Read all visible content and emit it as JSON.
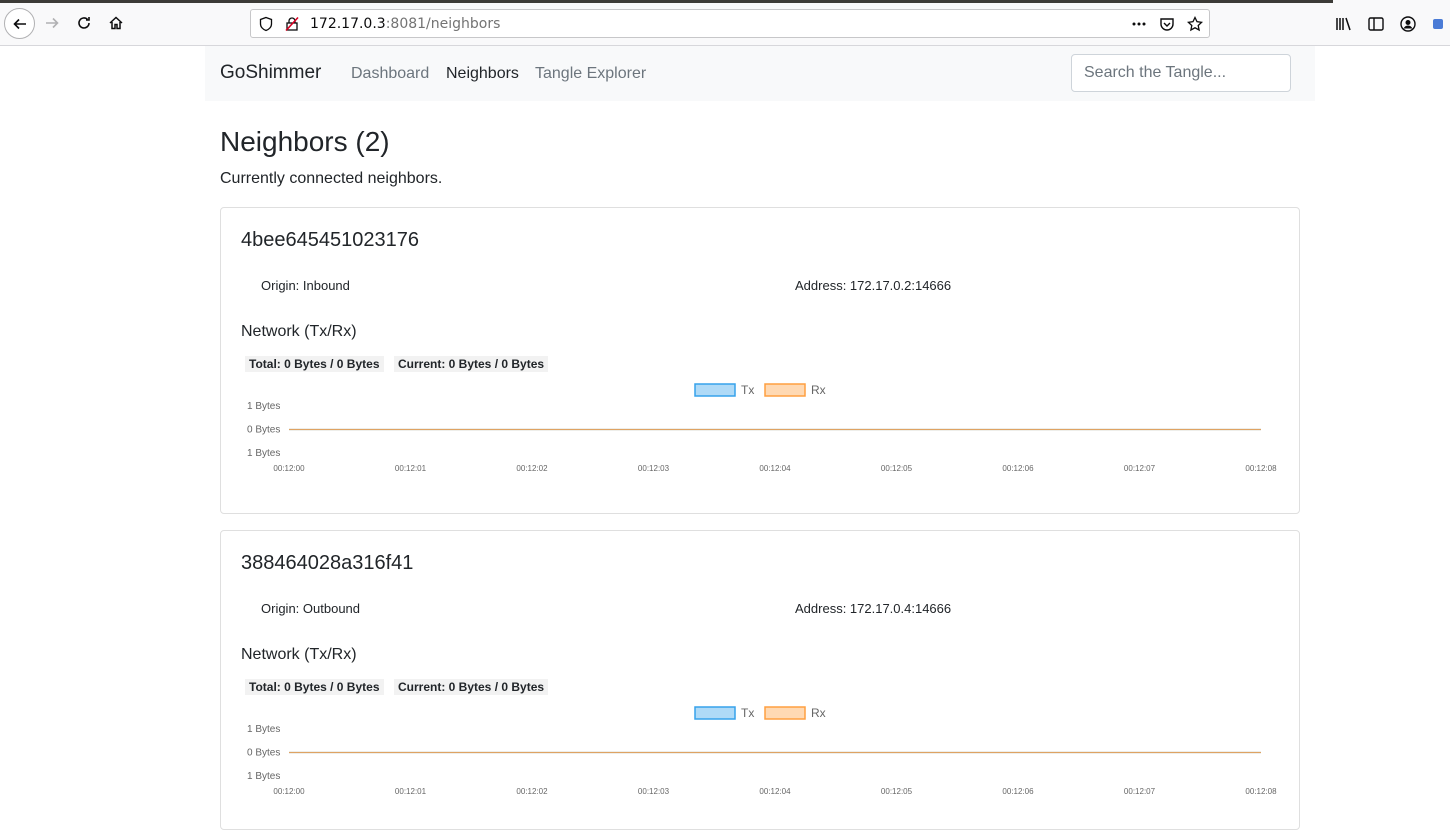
{
  "browser": {
    "url_host": "172.17.0.3",
    "url_rest": ":8081/neighbors"
  },
  "navbar": {
    "brand": "GoShimmer",
    "links": [
      "Dashboard",
      "Neighbors",
      "Tangle Explorer"
    ],
    "active_link": "Neighbors",
    "search_placeholder": "Search the Tangle..."
  },
  "page": {
    "title": "Neighbors (2)",
    "subtitle": "Currently connected neighbors."
  },
  "neighbors": [
    {
      "id": "4bee645451023176",
      "origin": "Origin: Inbound",
      "address": "Address: 172.17.0.2:14666",
      "network_title": "Network (Tx/Rx)",
      "total": "Total: 0 Bytes / 0 Bytes",
      "current": "Current: 0 Bytes / 0 Bytes"
    },
    {
      "id": "388464028a316f41",
      "origin": "Origin: Outbound",
      "address": "Address: 172.17.0.4:14666",
      "network_title": "Network (Tx/Rx)",
      "total": "Total: 0 Bytes / 0 Bytes",
      "current": "Current: 0 Bytes / 0 Bytes"
    }
  ],
  "chart_data": [
    {
      "type": "line",
      "legend": [
        "Tx",
        "Rx"
      ],
      "colors": {
        "Tx": "#36a2eb",
        "Rx": "#ff9f40"
      },
      "x": [
        "00:12:00",
        "00:12:01",
        "00:12:02",
        "00:12:03",
        "00:12:04",
        "00:12:05",
        "00:12:06",
        "00:12:07",
        "00:12:08"
      ],
      "y_ticks": [
        "1 Bytes",
        "0 Bytes",
        "1 Bytes"
      ],
      "series": [
        {
          "name": "Tx",
          "values": [
            0,
            0,
            0,
            0,
            0,
            0,
            0,
            0,
            0
          ]
        },
        {
          "name": "Rx",
          "values": [
            0,
            0,
            0,
            0,
            0,
            0,
            0,
            0,
            0
          ]
        }
      ],
      "legend_position": "top"
    },
    {
      "type": "line",
      "legend": [
        "Tx",
        "Rx"
      ],
      "colors": {
        "Tx": "#36a2eb",
        "Rx": "#ff9f40"
      },
      "x": [
        "00:12:00",
        "00:12:01",
        "00:12:02",
        "00:12:03",
        "00:12:04",
        "00:12:05",
        "00:12:06",
        "00:12:07",
        "00:12:08"
      ],
      "y_ticks": [
        "1 Bytes",
        "0 Bytes",
        "1 Bytes"
      ],
      "series": [
        {
          "name": "Tx",
          "values": [
            0,
            0,
            0,
            0,
            0,
            0,
            0,
            0,
            0
          ]
        },
        {
          "name": "Rx",
          "values": [
            0,
            0,
            0,
            0,
            0,
            0,
            0,
            0,
            0
          ]
        }
      ],
      "legend_position": "top"
    }
  ]
}
